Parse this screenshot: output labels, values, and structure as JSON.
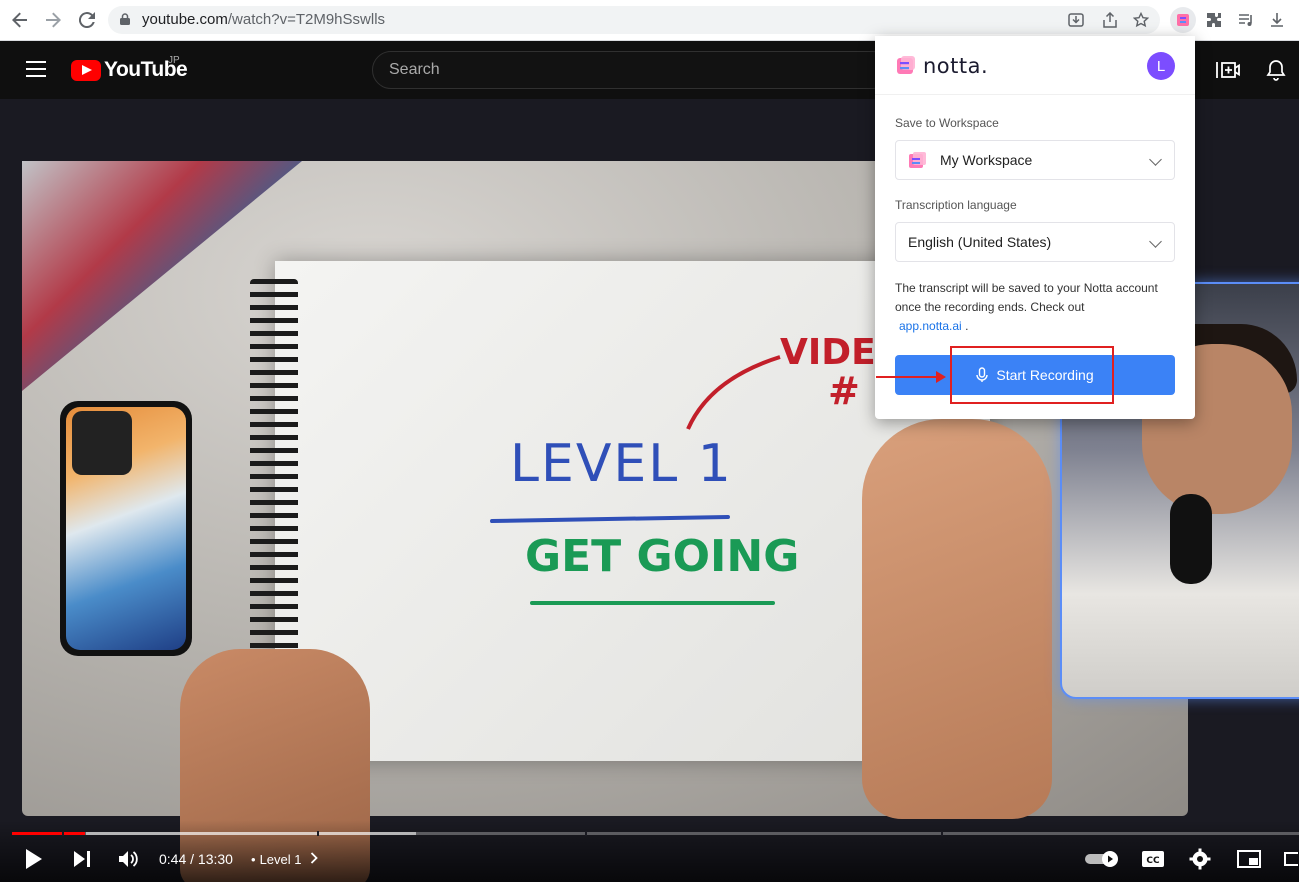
{
  "browser": {
    "url_host": "youtube.com",
    "url_path": "/watch?v=T2M9hSswlls",
    "icons": [
      "back-icon",
      "forward-icon",
      "reload-icon",
      "lock-icon",
      "install-icon",
      "share-icon",
      "bookmark-star-icon",
      "notta-extension-icon",
      "extensions-puzzle-icon",
      "media-control-icon",
      "download-icon"
    ]
  },
  "youtube": {
    "logo_text": "YouTube",
    "region": "JP",
    "search_placeholder": "Search",
    "player": {
      "time": "0:44 / 13:30",
      "chapter_separator": "•",
      "chapter": "Level 1",
      "progress_fraction": 0.057,
      "video_text": {
        "level": "LEVEL 1",
        "subtitle": "GET GOING",
        "corner_word": "VIDE",
        "corner_hash": "#"
      }
    }
  },
  "notta": {
    "logo_text": "notta.",
    "avatar_initial": "L",
    "workspace_label": "Save to Workspace",
    "workspace_value": "My Workspace",
    "language_label": "Transcription language",
    "language_value": "English (United States)",
    "info_text": "The transcript will be saved to your Notta account once the recording ends. Check out",
    "info_link": "app.notta.ai",
    "info_suffix": ".",
    "start_button": "Start Recording",
    "accent": "#3b82f6"
  }
}
